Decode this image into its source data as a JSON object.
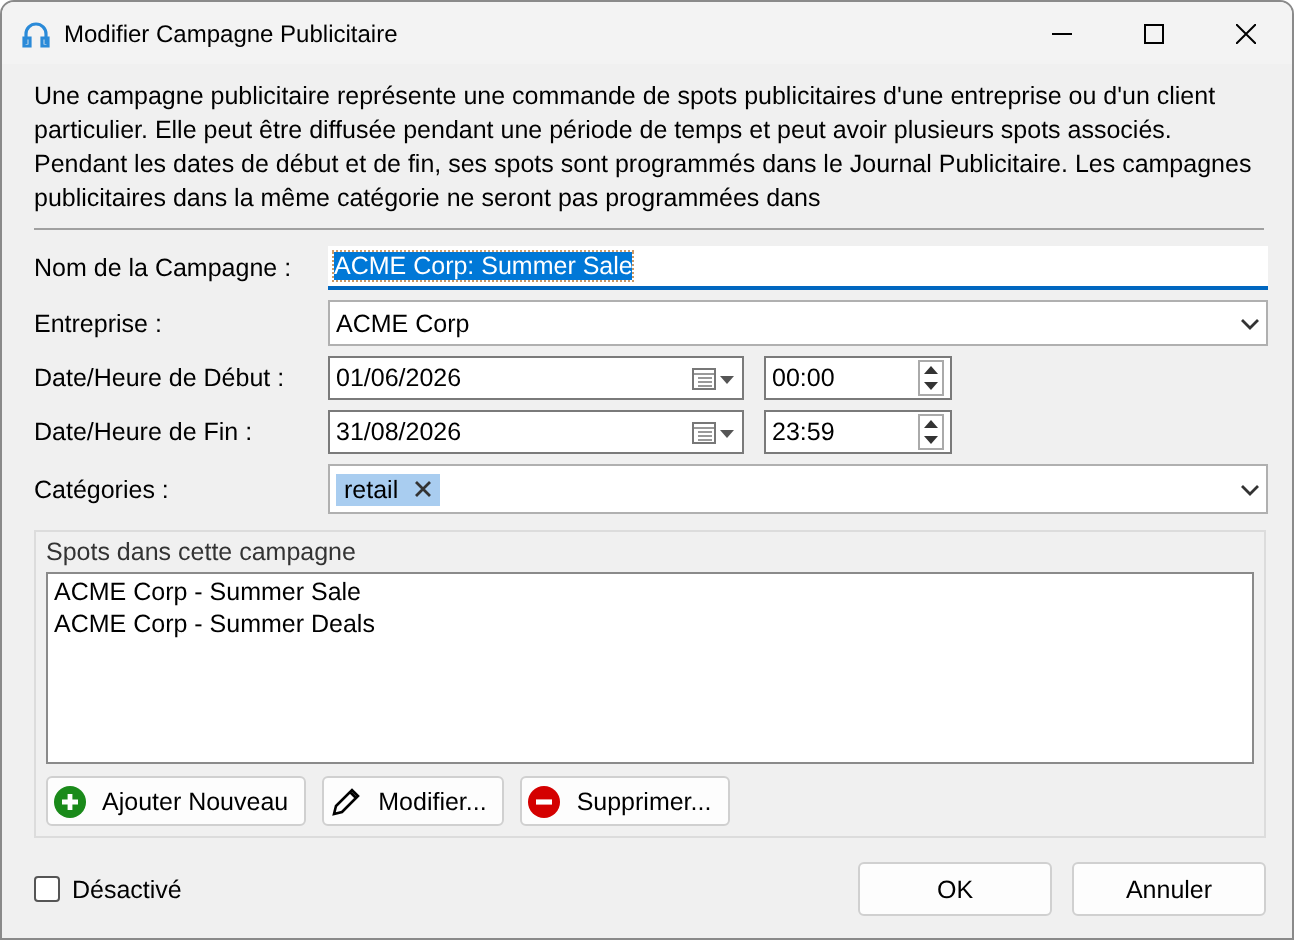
{
  "window": {
    "title": "Modifier Campagne Publicitaire"
  },
  "description": "Une campagne publicitaire représente une commande de spots publicitaires d'une entreprise ou d'un client particulier. Elle peut être diffusée pendant une période de temps et peut avoir plusieurs spots associés. Pendant les dates de début et de fin, ses spots sont programmés dans le Journal Publicitaire. Les campagnes publicitaires dans la même catégorie ne seront pas programmées dans",
  "form": [
    {
      "kind": "text",
      "label": "Nom de la Campagne :",
      "value": "ACME Corp: Summer Sale",
      "focused": true
    },
    {
      "kind": "combo",
      "label": "Entreprise :",
      "value": "ACME Corp"
    },
    {
      "kind": "datetime",
      "label": "Date/Heure de Début :",
      "date": "01/06/2026",
      "time": "00:00"
    },
    {
      "kind": "datetime",
      "label": "Date/Heure de Fin :",
      "date": "31/08/2026",
      "time": "23:59"
    },
    {
      "kind": "tags",
      "label": "Catégories :",
      "tags": [
        "retail"
      ]
    }
  ],
  "spots": {
    "title": "Spots dans cette campagne",
    "items": [
      "ACME Corp - Summer Sale",
      "ACME Corp - Summer Deals"
    ],
    "buttons": [
      {
        "kind": "add",
        "label": "Ajouter Nouveau"
      },
      {
        "kind": "edit",
        "label": "Modifier..."
      },
      {
        "kind": "delete",
        "label": "Supprimer..."
      }
    ]
  },
  "disabled": {
    "label": "Désactivé",
    "checked": false
  },
  "buttons": [
    "OK",
    "Annuler"
  ]
}
